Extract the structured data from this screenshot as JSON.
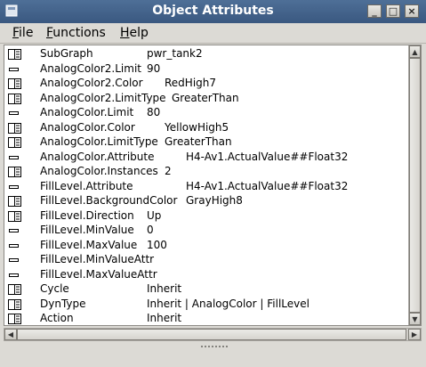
{
  "window": {
    "title": "Object Attributes"
  },
  "menu": [
    "File",
    "Functions",
    "Help"
  ],
  "attributes": [
    {
      "key": "SubGraph",
      "value": "pwr_tank2",
      "icon": "edit-icon"
    },
    {
      "key": "AnalogColor2.Limit",
      "value": "90",
      "icon": "dash-icon"
    },
    {
      "key": "AnalogColor2.Color",
      "value": "RedHigh7",
      "icon": "edit-icon"
    },
    {
      "key": "AnalogColor2.LimitType",
      "value": "GreaterThan",
      "icon": "edit-icon"
    },
    {
      "key": "AnalogColor.Limit",
      "value": "80",
      "icon": "dash-icon"
    },
    {
      "key": "AnalogColor.Color",
      "value": "YellowHigh5",
      "icon": "edit-icon"
    },
    {
      "key": "AnalogColor.LimitType",
      "value": "GreaterThan",
      "icon": "edit-icon"
    },
    {
      "key": "AnalogColor.Attribute",
      "value": "H4-Av1.ActualValue##Float32",
      "icon": "dash-icon"
    },
    {
      "key": "AnalogColor.Instances",
      "value": "2",
      "icon": "edit-icon"
    },
    {
      "key": "FillLevel.Attribute",
      "value": "H4-Av1.ActualValue##Float32",
      "icon": "dash-icon"
    },
    {
      "key": "FillLevel.BackgroundColor",
      "value": "GrayHigh8",
      "icon": "edit-icon"
    },
    {
      "key": "FillLevel.Direction",
      "value": "Up",
      "icon": "edit-icon"
    },
    {
      "key": "FillLevel.MinValue",
      "value": "0",
      "icon": "dash-icon"
    },
    {
      "key": "FillLevel.MaxValue",
      "value": "100",
      "icon": "dash-icon"
    },
    {
      "key": "FillLevel.MinValueAttr",
      "value": "",
      "icon": "dash-icon"
    },
    {
      "key": "FillLevel.MaxValueAttr",
      "value": "",
      "icon": "dash-icon"
    },
    {
      "key": "Cycle",
      "value": "Inherit",
      "icon": "edit-icon"
    },
    {
      "key": "DynType",
      "value": "Inherit | AnalogColor | FillLevel",
      "icon": "edit-icon"
    },
    {
      "key": "Action",
      "value": "Inherit",
      "icon": "edit-icon"
    }
  ]
}
